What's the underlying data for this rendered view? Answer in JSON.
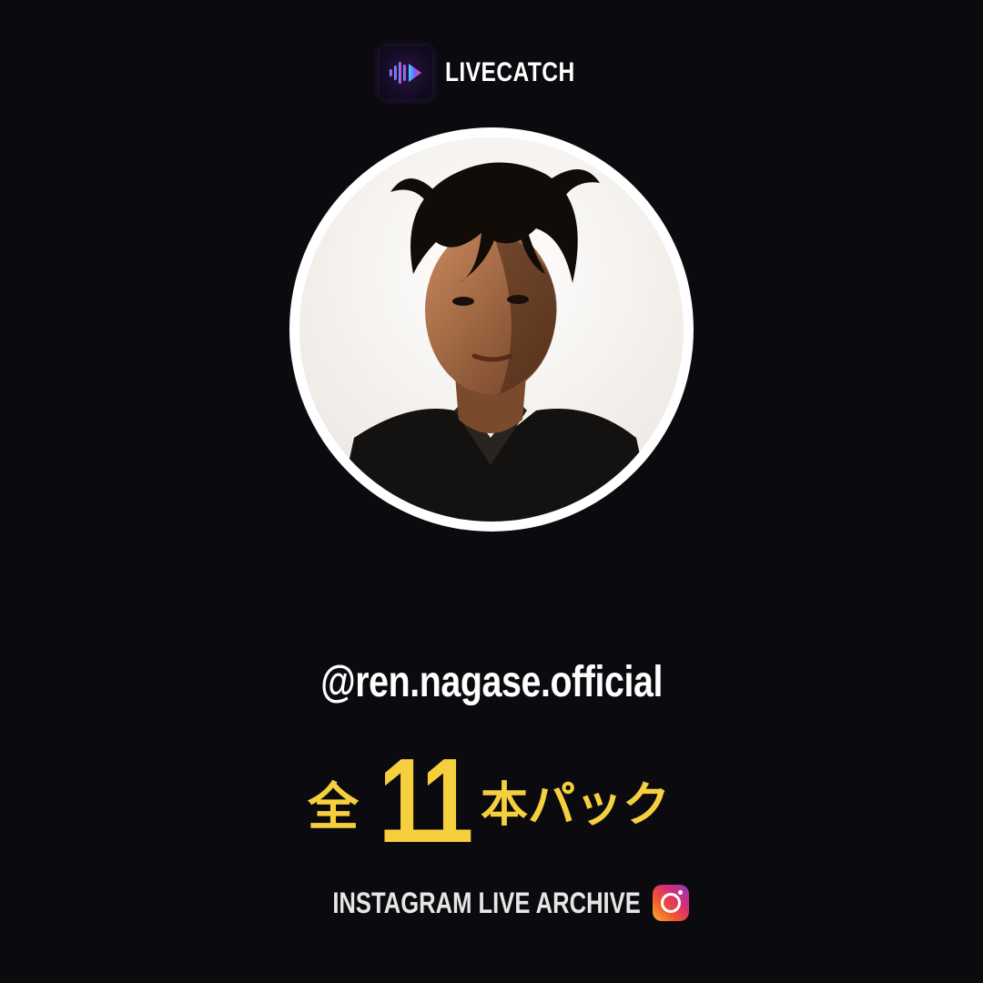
{
  "brand": {
    "name": "LIVECATCH",
    "logo_icon": "waveform-play-icon"
  },
  "profile": {
    "avatar": "profile-photo",
    "handle": "@ren.nagase.official"
  },
  "pack": {
    "prefix": "全",
    "count": "11",
    "suffix": "本パック"
  },
  "footer": {
    "label": "INSTAGRAM LIVE ARCHIVE",
    "icon": "instagram-icon"
  },
  "colors": {
    "background": "#0b0a0e",
    "accent": "#f6cf3f",
    "text": "#ffffff"
  }
}
